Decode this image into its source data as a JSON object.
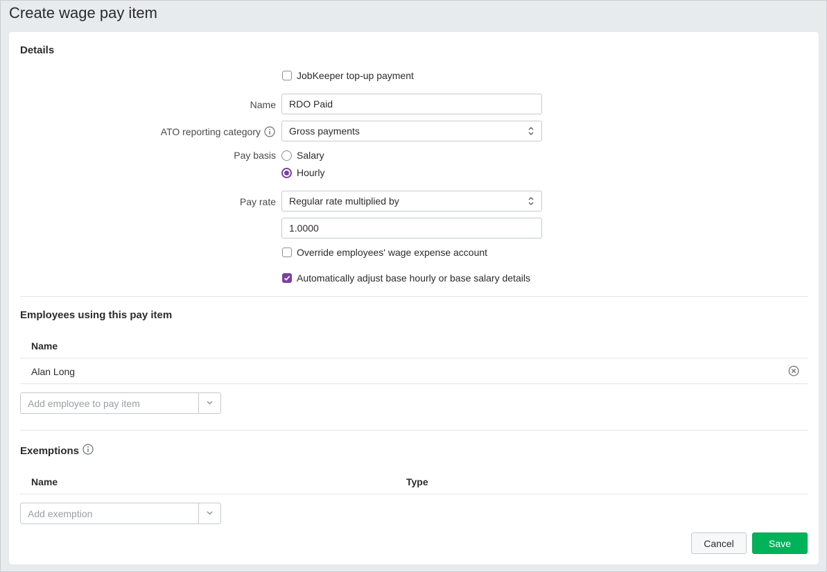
{
  "page": {
    "title": "Create wage pay item"
  },
  "details": {
    "heading": "Details",
    "jobkeeper_label": "JobKeeper top-up payment",
    "jobkeeper_checked": false,
    "name_label": "Name",
    "name_value": "RDO Paid",
    "ato_label": "ATO reporting category",
    "ato_value": "Gross payments",
    "pay_basis_label": "Pay basis",
    "pay_basis_options": [
      "Salary",
      "Hourly"
    ],
    "pay_basis_selected": "Hourly",
    "pay_rate_label": "Pay rate",
    "pay_rate_value": "Regular rate multiplied by",
    "multiplier_value": "1.0000",
    "override_label": "Override employees' wage expense account",
    "override_checked": false,
    "auto_adjust_label": "Automatically adjust base hourly or base salary details",
    "auto_adjust_checked": true
  },
  "employees": {
    "heading": "Employees using this pay item",
    "column_name": "Name",
    "rows": [
      {
        "name": "Alan Long"
      }
    ],
    "add_placeholder": "Add employee to pay item"
  },
  "exemptions": {
    "heading": "Exemptions",
    "column_name": "Name",
    "column_type": "Type",
    "add_placeholder": "Add exemption"
  },
  "actions": {
    "cancel_label": "Cancel",
    "save_label": "Save"
  },
  "colors": {
    "accent": "#7b3fa0",
    "save": "#00b35a"
  },
  "icons": [
    "info-icon",
    "select-arrows-icon",
    "chevron-down-icon",
    "remove-icon",
    "checkmark-icon"
  ]
}
